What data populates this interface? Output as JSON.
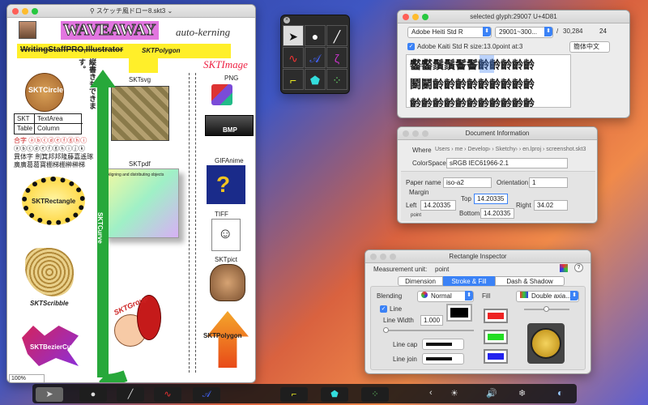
{
  "main_window": {
    "title": "スケッチ風ドロー8.skt3",
    "title_chevron": "⌄",
    "waveaway": "WAVEAWAY",
    "auto_kerning": "auto-kerning",
    "writing_staff": "WritingStaffPRO,Illustrator",
    "skt_polygon_label": "SKTPolygon",
    "skt_image": "SKTImage",
    "vertical_text": "縦書きもできます。",
    "skt_circle": "SKTCircle",
    "skt_svg": "SKTsvg",
    "png": "PNG",
    "table": {
      "r1": [
        "SKT",
        "TextArea"
      ],
      "r2": [
        "Table",
        "Column"
      ]
    },
    "jp_line1": "合字 ⓐⓑⓒⓓⓔⓕⓖⓗⓘ",
    "jp_line2": "ⓐⓑⓒⓓⓔⓕⓖⓗⓘⓙⓚ",
    "jp_line3": "異体字 劍箕邦邦隆藤嘉遙琢",
    "jp_line4": "廣廣葛葛寶棚梯棚榊榊梯",
    "skt_pdf": "SKTpdf",
    "gif_anime": "GIFAnime",
    "bmp": "BMP",
    "skt_rectangle": "SKTRectangle",
    "skt_curve": "SKTCurve",
    "tiff": "TIFF",
    "skt_scribble": "SKTScribble",
    "skt_pict": "SKTpict",
    "skt_group": "SKTGroup",
    "skt_bezier": "SKTBezierCurve",
    "skt_polygon2": "SKTPolygon",
    "pdf_heading": "Aligning and distributing objects",
    "zoom": "100%"
  },
  "glyph_window": {
    "title": "selected glyph:29007 U+4D81",
    "font_popup": "Adobe Heiti Std R",
    "range_popup": "29001~300...",
    "slash": "/",
    "total": "30,284",
    "size": "24",
    "checkbox_label": "Adobe Kaiti Std R size:13.0point at:3",
    "lang_popup": "簡体中文",
    "glyph_rows": [
      "齾齾鬚鬚鬠鬠齡齡齡齡齡",
      "鬬鬭齡齡齡齡齡齡齡齡齡",
      "齡齡齡齡齡齡齡齡齡齡齡"
    ]
  },
  "doc_info": {
    "title": "Document Information",
    "where_label": "Where",
    "where_path": "Users › me › Develop› › Sketchy› › en.lproj › screenshot.skt3",
    "colorspace_label": "ColorSpace",
    "colorspace_value": "sRGB IEC61966-2.1",
    "paper_label": "Paper name",
    "paper_value": "iso-a2",
    "orientation_label": "Orientation",
    "orientation_value": "1",
    "margin_label": "Margin",
    "left_label": "Left",
    "left_value": "14.20335",
    "top_label": "Top",
    "top_value": "14.20335",
    "right_label": "Right",
    "right_value": "34.02",
    "bottom_label": "Bottom",
    "bottom_value": "14.20335",
    "point_label": "point"
  },
  "rect_inspector": {
    "title": "Rectangle Inspector",
    "unit_label": "Measurement unit:",
    "unit_value": "point",
    "help": "?",
    "tabs": [
      "Dimension",
      "Stroke & Fill",
      "Dash & Shadow"
    ],
    "blending_label": "Blending",
    "blending_value": "Normal",
    "fill_label": "Fill",
    "fill_value": "Double axia...",
    "line_label": "Line",
    "line_width_label": "Line Width",
    "line_width_value": "1.000",
    "line_cap_label": "Line cap",
    "line_join_label": "Line join"
  },
  "dock": {
    "items": [
      "pointer",
      "shapes",
      "line",
      "scribble",
      "bezier",
      "curve",
      "polygon",
      "dots"
    ],
    "right": [
      "‹",
      "☀",
      "🔊",
      "❄",
      "◐"
    ]
  },
  "colors": {
    "red": "#ee2222",
    "green": "#22dd22",
    "blue": "#2222ee",
    "accent": "#3b82f6"
  }
}
